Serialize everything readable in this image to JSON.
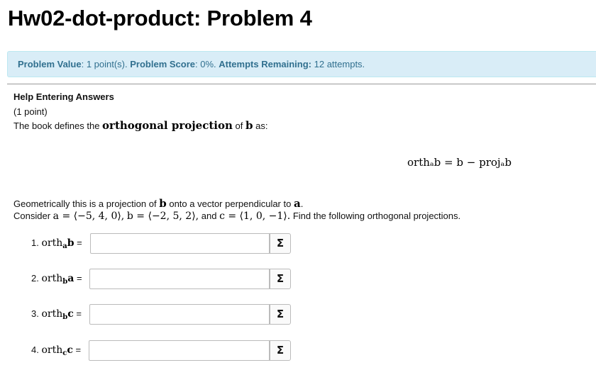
{
  "page_title": "Hw02-dot-product: Problem 4",
  "info": {
    "value_label": "Problem Value",
    "value_text": ": 1 point(s).",
    "score_label": "Problem Score",
    "score_text": ": 0%.",
    "attempts_label": "Attempts Remaining:",
    "attempts_text": "12 attempts."
  },
  "problem": {
    "help_link": "Help Entering Answers",
    "points": "(1 point)",
    "defn_prefix": "The book defines the",
    "defn_term": "orthogonal projection",
    "defn_of": "of",
    "defn_var": "b",
    "defn_suffix": "as:",
    "display_formula": "orthₐb = b − projₐb",
    "geo_prefix": "Geometrically this is a projection of",
    "geo_b": "b",
    "geo_mid": "onto a vector perpendicular to",
    "geo_a": "a",
    "geo_end": ".",
    "consider_prefix": "Consider",
    "vec_a": "a = ⟨−5, 4, 0⟩,",
    "vec_b": "b = ⟨−2, 5, 2⟩,",
    "and_text": "and",
    "vec_c": "c = ⟨1, 0, −1⟩.",
    "consider_suffix": "Find the following orthogonal projections."
  },
  "questions": [
    {
      "num": "1.",
      "orth": "orth",
      "sub": "a",
      "arg": "b",
      "eq": "=",
      "value": ""
    },
    {
      "num": "2.",
      "orth": "orth",
      "sub": "b",
      "arg": "a",
      "eq": "=",
      "value": ""
    },
    {
      "num": "3.",
      "orth": "orth",
      "sub": "b",
      "arg": "c",
      "eq": "=",
      "value": ""
    },
    {
      "num": "4.",
      "orth": "orth",
      "sub": "c",
      "arg": "c",
      "eq": "=",
      "value": ""
    }
  ],
  "sigma_icon": "Σ"
}
